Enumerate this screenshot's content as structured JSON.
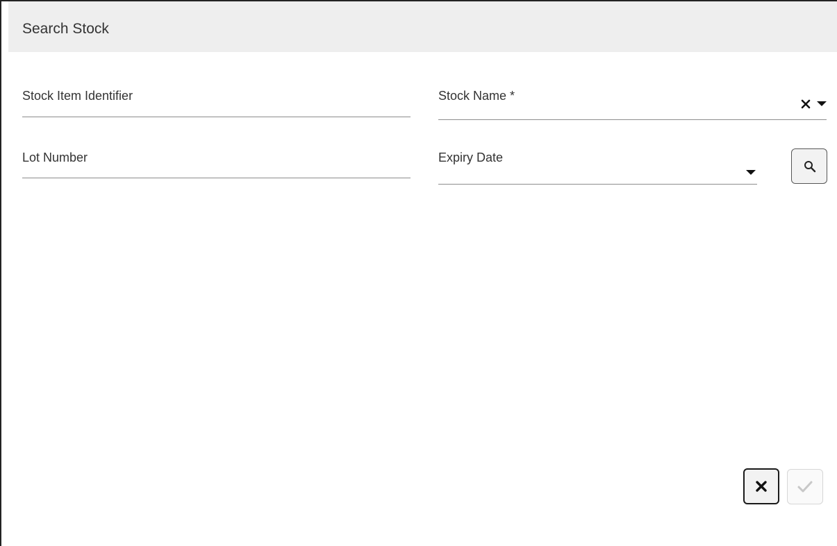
{
  "dialog": {
    "title": "Search Stock"
  },
  "form": {
    "stock_item_identifier": {
      "label": "Stock Item Identifier",
      "value": ""
    },
    "stock_name": {
      "label": "Stock Name *",
      "value": ""
    },
    "lot_number": {
      "label": "Lot Number",
      "value": ""
    },
    "expiry_date": {
      "label": "Expiry Date",
      "value": ""
    }
  },
  "icons": {
    "clear": "close-icon",
    "dropdown": "caret-down-icon",
    "search": "magnifier-icon",
    "cancel": "close-icon",
    "confirm": "checkmark-icon"
  },
  "colors": {
    "header_bg": "#eeeeee",
    "underline": "#8c8c8c",
    "disabled_check": "#c8c8c8"
  }
}
